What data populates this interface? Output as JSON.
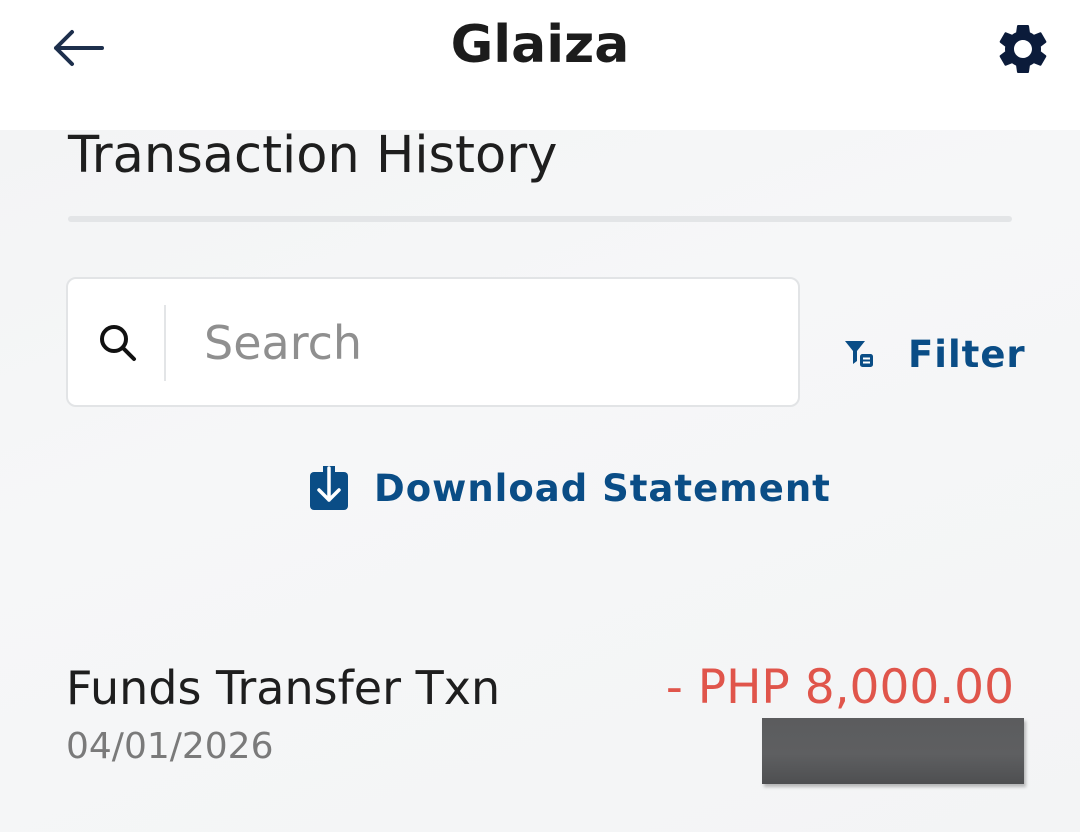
{
  "header": {
    "title": "Glaiza",
    "back_icon": "arrow-left-icon",
    "settings_icon": "gear-icon"
  },
  "section": {
    "title": "Transaction History"
  },
  "search": {
    "placeholder": "Search",
    "value": "",
    "icon": "search-icon"
  },
  "filter": {
    "label": "Filter",
    "icon": "filter-icon"
  },
  "download": {
    "label": "Download Statement",
    "icon": "download-icon"
  },
  "transactions": [
    {
      "name": "Funds Transfer Txn",
      "date": "04/01/2026",
      "amount": "- PHP 8,000.00"
    }
  ],
  "colors": {
    "accent": "#0a4d86",
    "debit": "#e0554b",
    "header_bg": "#ffffff",
    "page_bg": "#f4f5f6"
  }
}
